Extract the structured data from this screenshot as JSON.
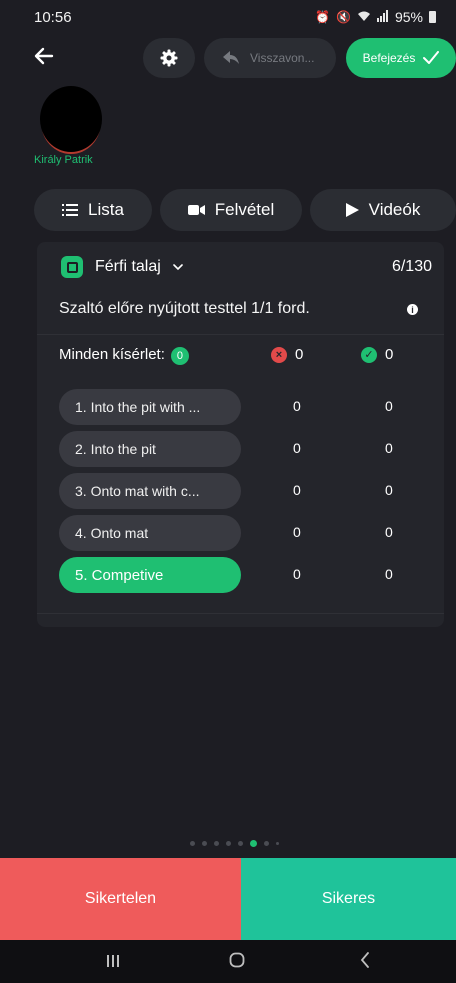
{
  "status_bar": {
    "time": "10:56",
    "battery": "95%"
  },
  "header": {
    "undo_label": "Visszavon...",
    "finish_label": "Befejezés"
  },
  "athlete": {
    "name": "Király Patrik"
  },
  "view_tabs": [
    {
      "label": "Lista",
      "icon": "list-icon"
    },
    {
      "label": "Felvétel",
      "icon": "camera-icon"
    },
    {
      "label": "Videók",
      "icon": "play-icon"
    }
  ],
  "card": {
    "discipline": "Férfi talaj",
    "counter": "6/130",
    "element_name": "Szaltó előre nyújtott testtel 1/1 ford.",
    "all_attempts_label": "Minden kísérlet:",
    "all_attempts_count": "0",
    "fail_total": "0",
    "success_total": "0",
    "variants": [
      {
        "label": "1. Into the pit with ...",
        "fail": "0",
        "success": "0",
        "active": false
      },
      {
        "label": "2. Into the pit",
        "fail": "0",
        "success": "0",
        "active": false
      },
      {
        "label": "3. Onto mat with c...",
        "fail": "0",
        "success": "0",
        "active": false
      },
      {
        "label": "4. Onto mat",
        "fail": "0",
        "success": "0",
        "active": false
      },
      {
        "label": "5. Competive",
        "fail": "0",
        "success": "0",
        "active": true
      }
    ]
  },
  "pager": {
    "total_dots": 8,
    "active_index": 5
  },
  "actions": {
    "fail_label": "Sikertelen",
    "success_label": "Sikeres"
  },
  "colors": {
    "accent": "#1fbf72",
    "fail": "#ef5b5b",
    "success": "#1fc39a",
    "background": "#1d1d23",
    "card": "#24252b"
  }
}
